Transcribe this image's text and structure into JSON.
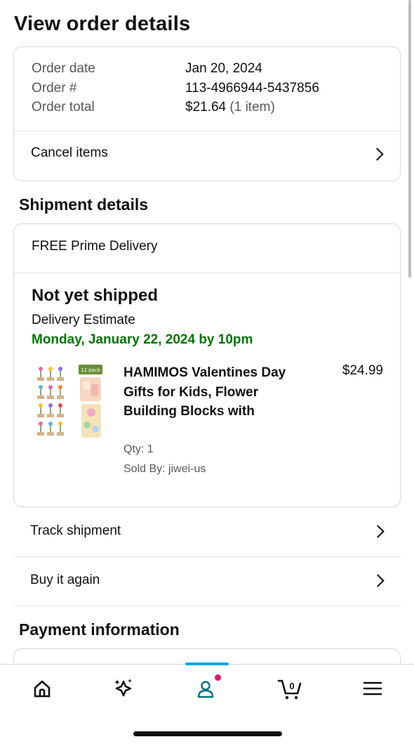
{
  "page": {
    "title": "View order details"
  },
  "order_summary": {
    "rows": [
      {
        "label": "Order date",
        "value": "Jan 20, 2024"
      },
      {
        "label": "Order #",
        "value": "113-4966944-5437856"
      },
      {
        "label": "Order total",
        "value": "$21.64",
        "extra": "(1 item)"
      }
    ],
    "cancel_label": "Cancel items"
  },
  "shipment": {
    "section_title": "Shipment details",
    "delivery_type": "FREE Prime Delivery",
    "status": "Not yet shipped",
    "estimate_label": "Delivery Estimate",
    "estimate_date": "Monday, January 22, 2024 by 10pm",
    "item": {
      "title": "HAMIMOS Valentines Day Gifts for Kids, Flower Building Blocks with",
      "price": "$24.99",
      "qty": "Qty: 1",
      "sold_by": "Sold By: jiwei-us",
      "image_label": "12 pack"
    },
    "track_label": "Track shipment",
    "buy_again_label": "Buy it again"
  },
  "payment": {
    "section_title": "Payment information"
  },
  "bottom_nav": {
    "items": [
      "home-icon",
      "ai-sparkle-icon",
      "account-icon",
      "cart-icon",
      "menu-icon"
    ],
    "cart_count": "0",
    "active": "account-icon",
    "accent_color": "#00a8e1"
  },
  "colors": {
    "green_estimate": "#007600",
    "badge": "#e4166d"
  }
}
